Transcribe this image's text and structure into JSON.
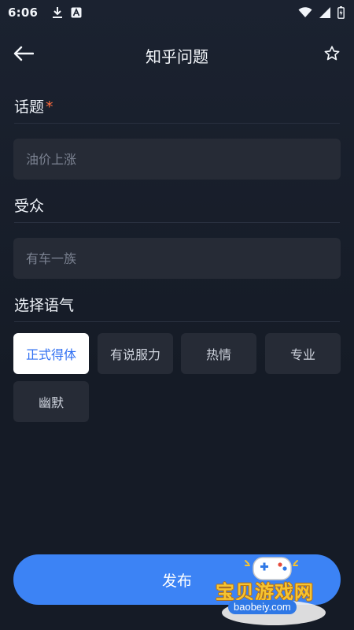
{
  "status_bar": {
    "time": "6:06",
    "left_icons": [
      "download-icon",
      "a-badge-icon"
    ],
    "right_icons": [
      "wifi-icon",
      "signal-icon",
      "battery-icon"
    ]
  },
  "header": {
    "title": "知乎问题",
    "back_icon": "arrow-left-icon",
    "favorite_icon": "star-outline-icon"
  },
  "topic": {
    "label": "话题",
    "required_mark": "*",
    "placeholder": "油价上涨"
  },
  "audience": {
    "label": "受众",
    "placeholder": "有车一族"
  },
  "tone": {
    "label": "选择语气",
    "options": [
      "正式得体",
      "有说服力",
      "热情",
      "专业",
      "幽默"
    ],
    "selected": "正式得体"
  },
  "publish_label": "发布",
  "watermark": {
    "title": "宝贝游戏网",
    "url": "baobeiy.com"
  },
  "colors": {
    "background": "#151b26",
    "input_bg": "#262b36",
    "accent": "#3c83f5",
    "required": "#ff6b3d",
    "selected_chip_text": "#2f6ff2"
  }
}
